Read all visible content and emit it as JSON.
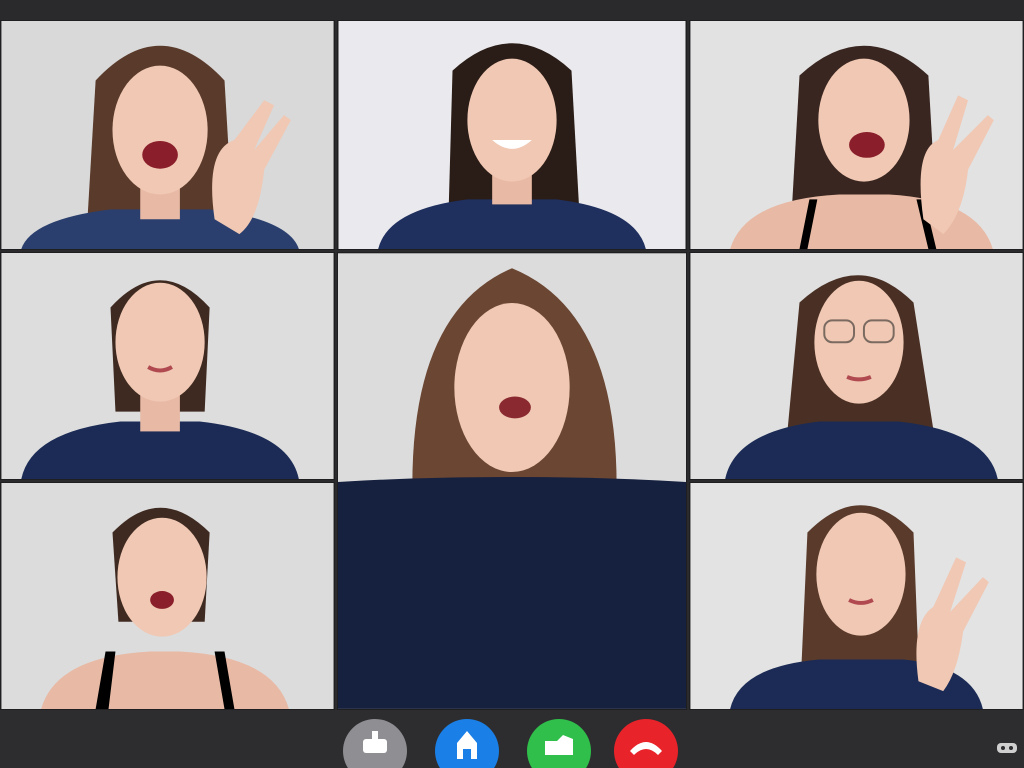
{
  "window": {
    "title": ""
  },
  "participants": [
    {
      "id": 1,
      "pose": "laughing-ok-hand",
      "top": "#2a3f6e"
    },
    {
      "id": 2,
      "pose": "smiling",
      "top": "#1f2f5e"
    },
    {
      "id": 3,
      "pose": "laughing-ok-hand",
      "top": "#000000"
    },
    {
      "id": 4,
      "pose": "neutral",
      "top": "#1b2b55"
    },
    {
      "id": 5,
      "pose": "talking-featured",
      "top": "#16203f"
    },
    {
      "id": 6,
      "pose": "glasses-neutral",
      "top": "#1b2b55"
    },
    {
      "id": 7,
      "pose": "surprised",
      "top": "#000000"
    },
    {
      "id": 8,
      "pose": "smiling-ok-hand",
      "top": "#1b2b55"
    }
  ],
  "controls": [
    {
      "name": "gray-action-button",
      "icon": "chat-icon",
      "color": "#8e8e93"
    },
    {
      "name": "blue-action-button",
      "icon": "person-icon",
      "color": "#1a7fe6"
    },
    {
      "name": "green-action-button",
      "icon": "camera-icon",
      "color": "#2fbf4a"
    },
    {
      "name": "end-call-button",
      "icon": "hang-up-icon",
      "color": "#e8232a"
    }
  ],
  "colors": {
    "background": "#2b2b2d",
    "tileWall": "#dcdcdc",
    "skin": "#f0c8b4",
    "hair": "#4a2f22"
  }
}
